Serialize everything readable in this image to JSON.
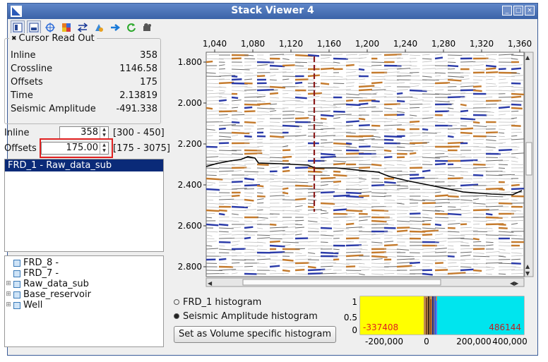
{
  "window": {
    "title": "Stack Viewer 4"
  },
  "toolbar": {
    "icons": [
      "view-mode-icon",
      "view-mode-2-icon",
      "crosshair-icon",
      "palette-icon",
      "flip-axis-icon",
      "display-settings-icon",
      "navigate-icon",
      "refresh-icon",
      "snapshot-icon"
    ]
  },
  "readout": {
    "title": "Cursor Read Out",
    "rows": [
      {
        "label": "Inline",
        "value": "358"
      },
      {
        "label": "Crossline",
        "value": "1146.58"
      },
      {
        "label": "Offsets",
        "value": "175"
      },
      {
        "label": "Time",
        "value": "2.13819"
      },
      {
        "label": "Seismic Amplitude",
        "value": "-491.338"
      }
    ]
  },
  "inline": {
    "label": "Inline",
    "value": "358",
    "range": "[300 - 450]"
  },
  "offsets": {
    "label": "Offsets",
    "value": "175.00",
    "range": "[175 - 3075]"
  },
  "datalist": {
    "selected": "FRD_1 - Raw_data_sub"
  },
  "tree": [
    {
      "label": "FRD_8 -",
      "expandable": false
    },
    {
      "label": "FRD_7 -",
      "expandable": false
    },
    {
      "label": "Raw_data_sub",
      "expandable": true
    },
    {
      "label": "Base_reservoir",
      "expandable": true
    },
    {
      "label": "Well",
      "expandable": true
    }
  ],
  "section_plot": {
    "x_ticks": [
      "1,040",
      "1,080",
      "1,120",
      "1,160",
      "1,200",
      "1,240",
      "1,280",
      "1,320",
      "1,360"
    ],
    "y_ticks": [
      "1.800",
      "2.000",
      "2.200",
      "2.400",
      "2.600",
      "2.800"
    ],
    "colors": {
      "positive": "#c47a2c",
      "negative": "#2a3aa8",
      "cursor": "#8b1a1a",
      "horizon": "#000000"
    }
  },
  "histogram": {
    "options": [
      {
        "label": "FRD_1 histogram",
        "selected": false
      },
      {
        "label": "Seismic Amplitude histogram",
        "selected": true
      }
    ],
    "button_label": "Set as Volume specific histogram",
    "min_label": "-337408",
    "max_label": "486144",
    "y_ticks": [
      "1",
      "0.5",
      "0"
    ],
    "x_ticks": [
      "-200,000",
      "0",
      "200,000",
      "400,000"
    ],
    "colors": {
      "low": "#ffff00",
      "high": "#00e5ee"
    }
  }
}
